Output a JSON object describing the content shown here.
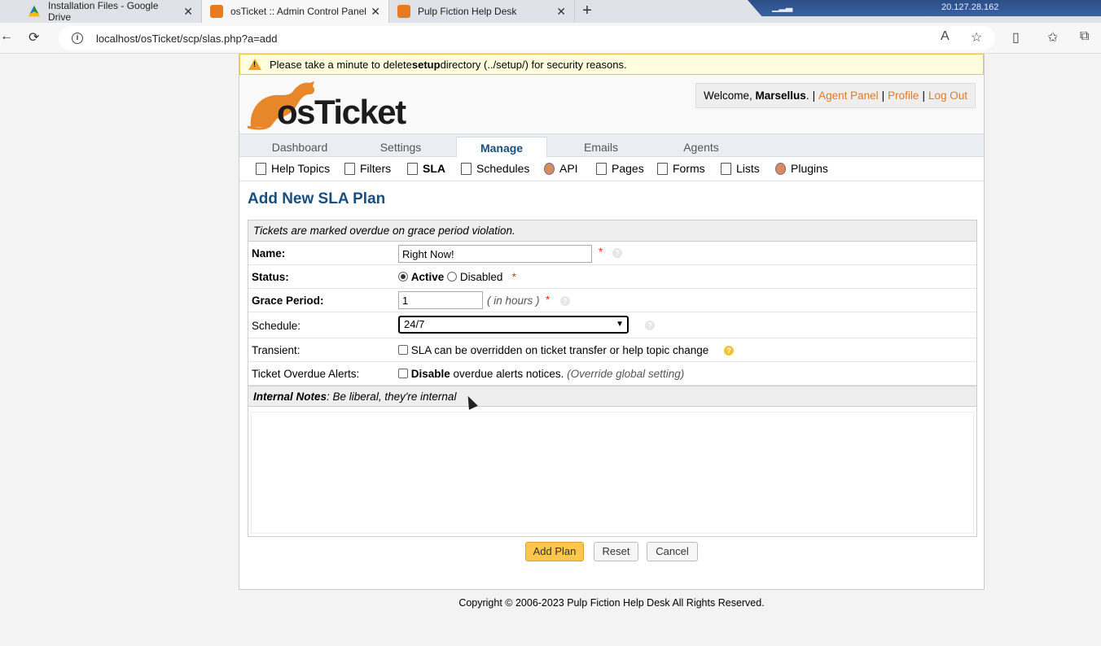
{
  "browser": {
    "tabs": [
      {
        "title": "Installation Files - Google Drive",
        "favicon": "google-drive-icon"
      },
      {
        "title": "osTicket :: Admin Control Panel",
        "favicon": "osticket-icon",
        "active": true
      },
      {
        "title": "Pulp Fiction Help Desk",
        "favicon": "osticket-icon"
      }
    ],
    "new_tab": "+",
    "remote_ip": "20.127.28.162",
    "url": "localhost/osTicket/scp/slas.php?a=add"
  },
  "warning": {
    "pre": "Please take a minute to delete ",
    "bold": "setup",
    "post": " directory (../setup/) for security reasons."
  },
  "logo": {
    "text": "osTicket"
  },
  "welcome": {
    "prefix": "Welcome, ",
    "user": "Marsellus",
    "suffix": ".",
    "links": [
      "Agent Panel",
      "Profile",
      "Log Out"
    ],
    "separator": "|"
  },
  "nav": {
    "tabs": [
      "Dashboard",
      "Settings",
      "Manage",
      "Emails",
      "Agents"
    ],
    "active": "Manage"
  },
  "subnav": {
    "items": [
      "Help Topics",
      "Filters",
      "SLA",
      "Schedules",
      "API",
      "Pages",
      "Forms",
      "Lists",
      "Plugins"
    ],
    "active": "SLA"
  },
  "page_title": "Add New SLA Plan",
  "form": {
    "header_note": "Tickets are marked overdue on grace period violation.",
    "name": {
      "label": "Name:",
      "value": "Right Now!"
    },
    "status": {
      "label": "Status:",
      "options": [
        "Active",
        "Disabled"
      ],
      "selected": "Active"
    },
    "grace": {
      "label": "Grace Period:",
      "value": "1",
      "unit": "( in hours )"
    },
    "schedule": {
      "label": "Schedule:",
      "value": "24/7"
    },
    "transient": {
      "label": "Transient:",
      "text": "SLA can be overridden on ticket transfer or help topic change"
    },
    "overdue": {
      "label": "Ticket Overdue Alerts:",
      "bold": "Disable",
      "text": " overdue alerts notices.",
      "italic": "(Override global setting)"
    },
    "notes": {
      "title": "Internal Notes",
      "subtitle": ": Be liberal, they're internal"
    },
    "required_mark": "*"
  },
  "buttons": {
    "add": "Add Plan",
    "reset": "Reset",
    "cancel": "Cancel"
  },
  "footer": "Copyright © 2006-2023 Pulp Fiction Help Desk All Rights Reserved."
}
